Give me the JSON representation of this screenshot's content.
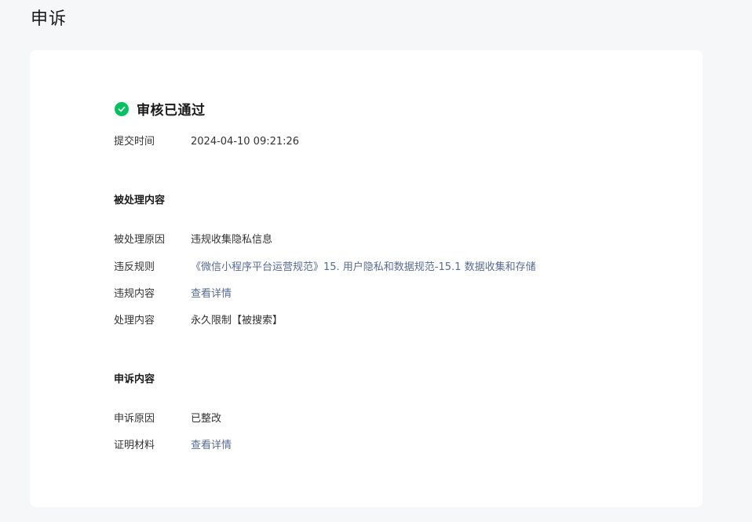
{
  "page": {
    "title": "申诉"
  },
  "status": {
    "text": "审核已通过",
    "color": "#07c160",
    "icon": "check-circle-icon"
  },
  "submit": {
    "label": "提交时间",
    "value": "2024-04-10 09:21:26"
  },
  "handled": {
    "section_title": "被处理内容",
    "rows": [
      {
        "label": "被处理原因",
        "value": "违规收集隐私信息"
      },
      {
        "label": "违反规则",
        "value": "《微信小程序平台运营规范》15. 用户隐私和数据规范-15.1 数据收集和存储"
      },
      {
        "label": "违规内容",
        "value": "查看详情"
      },
      {
        "label": "处理内容",
        "value": "永久限制【被搜索】"
      }
    ]
  },
  "appeal": {
    "section_title": "申诉内容",
    "rows": [
      {
        "label": "申诉原因",
        "value": "已整改"
      },
      {
        "label": "证明材料",
        "value": "查看详情"
      }
    ]
  },
  "colors": {
    "link": "#576b95",
    "background": "#f6f7f9",
    "card": "#ffffff"
  }
}
